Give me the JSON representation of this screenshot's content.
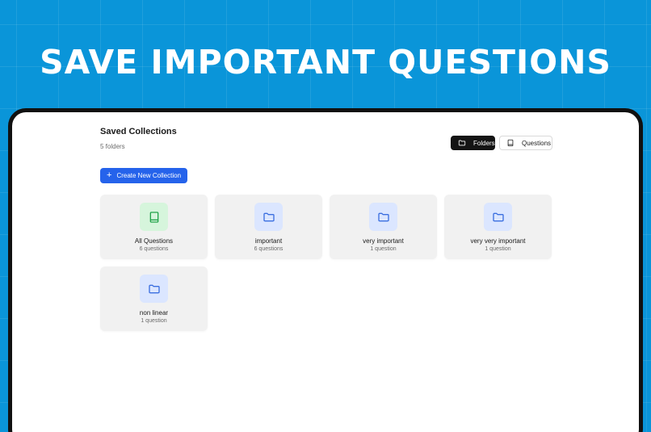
{
  "hero": {
    "title": "SAVE IMPORTANT QUESTIONS"
  },
  "header": {
    "title": "Saved Collections",
    "subtitle": "5 folders"
  },
  "view_toggle": {
    "folders_label": "Folders",
    "questions_label": "Questions",
    "selected": "Folders"
  },
  "create_button": {
    "label": "Create New Collection"
  },
  "collections": [
    {
      "name": "All Questions",
      "count": "6 questions",
      "icon": "book-icon"
    },
    {
      "name": "important",
      "count": "6 questions",
      "icon": "folder-icon"
    },
    {
      "name": "very important",
      "count": "1 question",
      "icon": "folder-icon"
    },
    {
      "name": "very very important",
      "count": "1 question",
      "icon": "folder-icon"
    },
    {
      "name": "non linear",
      "count": "1 question",
      "icon": "folder-icon"
    }
  ],
  "colors": {
    "background": "#0a95d9",
    "primary": "#2563eb",
    "folder_icon": "#3b6fe0",
    "folder_icon_bg": "#dbe6ff",
    "book_icon": "#22a34a",
    "book_icon_bg": "#d6f5dc",
    "card_bg": "#f1f1f1"
  }
}
